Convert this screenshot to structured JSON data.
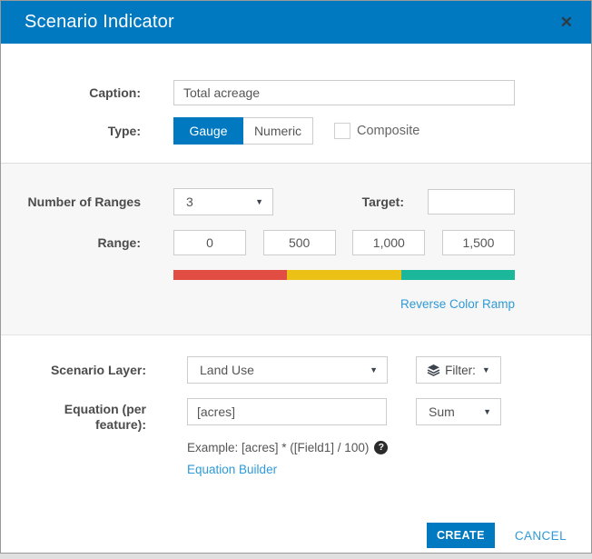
{
  "dialog": {
    "title": "Scenario Indicator",
    "close_icon": "✕"
  },
  "icons": {
    "dropdown_arrow": "▼",
    "help_glyph": "?"
  },
  "caption": {
    "label": "Caption:",
    "value": "Total acreage"
  },
  "type": {
    "label": "Type:",
    "options": [
      {
        "label": "Gauge",
        "selected": true
      },
      {
        "label": "Numeric",
        "selected": false
      }
    ],
    "composite_label": "Composite",
    "composite_checked": false
  },
  "ranges": {
    "number_label": "Number of Ranges",
    "number_value": "3",
    "target_label": "Target:",
    "target_value": "",
    "range_label": "Range:",
    "range_values": [
      "0",
      "500",
      "1,000",
      "1,500"
    ],
    "ramp_colors": [
      "#e14d43",
      "#ecc115",
      "#1bb79a"
    ],
    "reverse_link": "Reverse Color Ramp"
  },
  "layer": {
    "label": "Scenario Layer:",
    "value": "Land Use",
    "filter_label": "Filter:"
  },
  "equation": {
    "label": "Equation (per feature):",
    "value": "[acres]",
    "aggregation": "Sum",
    "example": "Example: [acres] * ([Field1] / 100)",
    "builder_link": "Equation Builder"
  },
  "footer": {
    "create": "CREATE",
    "cancel": "CANCEL"
  },
  "colors": {
    "accent": "#0079c1",
    "link": "#2e9ad7",
    "header_bg": "#0079c1",
    "section_bg": "#f7f7f7"
  }
}
